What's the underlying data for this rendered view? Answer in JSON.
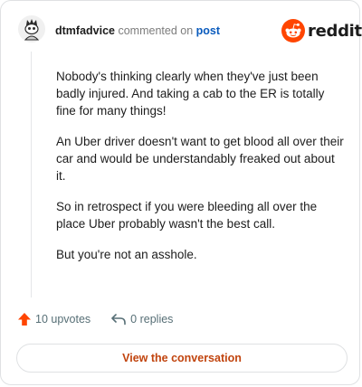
{
  "header": {
    "username": "dtmfadvice",
    "action_text": "commented on",
    "post_link": "post",
    "brand": "reddit"
  },
  "comment": {
    "paragraphs": [
      "Nobody's thinking clearly when they've just been badly injured. And taking a cab to the ER is totally fine for many things!",
      "An Uber driver doesn't want to get blood all over their car and would be understandably freaked out about it.",
      "So in retrospect if you were bleeding all over the place Uber probably wasn't the best call.",
      "But you're not an asshole."
    ]
  },
  "footer": {
    "upvotes": "10 upvotes",
    "replies": "0 replies",
    "view_button": "View the conversation"
  },
  "colors": {
    "brand_orange": "#FF4500",
    "link_blue": "#0A5BBD",
    "button_text": "#C1440E"
  },
  "icons": {
    "avatar": "snoo-avatar-icon",
    "brand": "reddit-logo-icon",
    "upvote": "upvote-arrow-icon",
    "reply": "reply-arrow-icon"
  }
}
